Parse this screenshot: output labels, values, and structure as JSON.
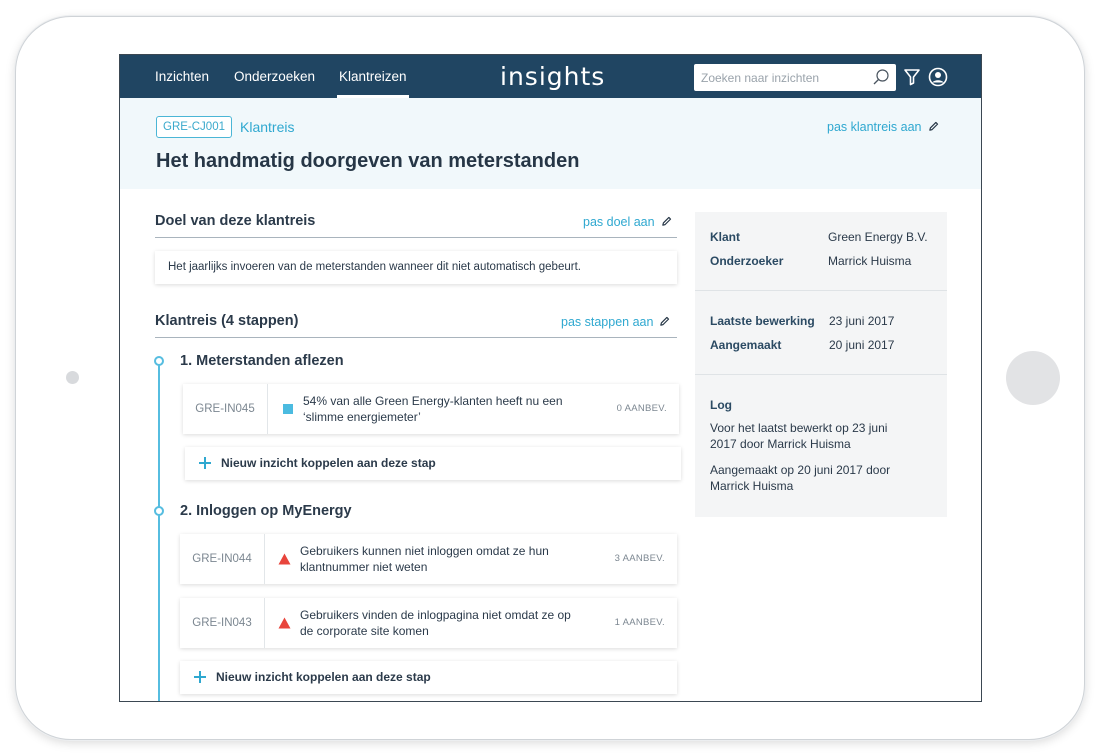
{
  "nav": {
    "items": [
      {
        "label": "Inzichten",
        "active": false
      },
      {
        "label": "Onderzoeken",
        "active": false
      },
      {
        "label": "Klantreizen",
        "active": true
      }
    ],
    "logo": "insights",
    "search_placeholder": "Zoeken naar inzichten",
    "icons": [
      "search-icon",
      "filter-icon",
      "user-icon"
    ]
  },
  "header": {
    "code": "GRE-CJ001",
    "type": "Klantreis",
    "edit_label": "pas klantreis aan",
    "title": "Het handmatig doorgeven van meterstanden"
  },
  "goal": {
    "title": "Doel van deze klantreis",
    "edit_label": "pas doel aan",
    "text": "Het jaarlijks invoeren van de meterstanden wanneer dit niet automatisch gebeurt."
  },
  "journey": {
    "title": "Klantreis (4 stappen)",
    "edit_label": "pas stappen aan",
    "add_label": "Nieuw inzicht koppelen aan deze stap",
    "steps": [
      {
        "title": "1. Meterstanden aflezen",
        "insights": [
          {
            "code": "GRE-IN045",
            "icon": "square-icon",
            "text": "54% van alle Green Energy-klanten heeft nu een ‘slimme energiemeter’",
            "count": "0 AANBEV."
          }
        ]
      },
      {
        "title": "2. Inloggen op MyEnergy",
        "insights": [
          {
            "code": "GRE-IN044",
            "icon": "warning-triangle-icon",
            "text": "Gebruikers kunnen niet inloggen omdat ze hun klantnummer niet weten",
            "count": "3 AANBEV."
          },
          {
            "code": "GRE-IN043",
            "icon": "warning-triangle-icon",
            "text": "Gebruikers vinden de inlogpagina niet omdat ze op de corporate site komen",
            "count": "1 AANBEV."
          }
        ]
      }
    ]
  },
  "side": {
    "client_key": "Klant",
    "client_val": "Green Energy B.V.",
    "researcher_key": "Onderzoeker",
    "researcher_val": "Marrick Huisma",
    "edited_key": "Laatste bewerking",
    "edited_val": "23 juni 2017",
    "created_key": "Aangemaakt",
    "created_val": "20 juni 2017",
    "log_title": "Log",
    "log_entries": [
      "Voor het laatst bewerkt op 23 juni 2017 door Marrick Huisma",
      "Aangemaakt op 20 juni 2017 door Marrick Huisma"
    ]
  },
  "colors": {
    "nav_bg": "#204562",
    "accent": "#2fa8d0",
    "timeline": "#56bde0",
    "warning": "#e8453c",
    "info": "#4bbbe0",
    "header_bg": "#f1f8fb",
    "side_bg": "#f4f5f6"
  }
}
